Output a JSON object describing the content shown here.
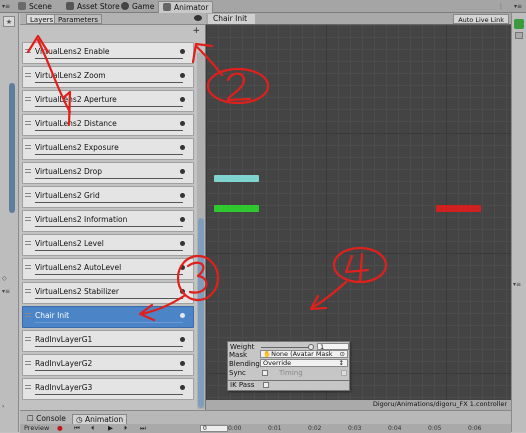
{
  "tabs": [
    {
      "label": "Scene",
      "icon": "scene-icon"
    },
    {
      "label": "Asset Store",
      "icon": "store-icon"
    },
    {
      "label": "Game",
      "icon": "game-icon"
    },
    {
      "label": "Animator",
      "icon": "animator-icon"
    }
  ],
  "layers_panel": {
    "tab_layers": "Layers",
    "tab_parameters": "Parameters",
    "add_label": "+",
    "items": [
      "VirtualLens2 Enable",
      "VirtualLens2 Zoom",
      "VirtualLens2 Aperture",
      "VirtualLens2 Distance",
      "VirtualLens2 Exposure",
      "VirtualLens2 Drop",
      "VirtualLens2 Grid",
      "VirtualLens2 Information",
      "VirtualLens2 Level",
      "VirtualLens2 AutoLevel",
      "VirtualLens2 Stabilizer",
      "Chair Init",
      "RadInvLayerG1",
      "RadInvLayerG2",
      "RadInvLayerG3"
    ],
    "selected": "Chair Init"
  },
  "graph": {
    "breadcrumb": "Chair Init",
    "auto_live_link": "Auto Live Link",
    "controller_path": "Digoru/Animations/digoru_FX 1.controller"
  },
  "layer_settings": {
    "weight_label": "Weight",
    "weight_value": "1",
    "mask_label": "Mask",
    "mask_value": "None (Avatar Mask",
    "blending_label": "Blending",
    "blending_value": "Override",
    "sync_label": "Sync",
    "timing_label": "Timing",
    "ik_pass_label": "IK Pass"
  },
  "bottom": {
    "console_label": "Console",
    "animation_label": "Animation",
    "preview_label": "Preview",
    "frame_value": "0",
    "timeline_marks": [
      "0:00",
      "0:01",
      "0:02",
      "0:03",
      "0:04",
      "0:05",
      "0:06"
    ]
  },
  "annotations": [
    "1",
    "2",
    "3",
    "4"
  ],
  "colors": {
    "selected": "#4c84c8",
    "annotation": "#e0201c",
    "node_entry": "#2fc82f",
    "node_exit": "#d02020",
    "node_state": "#7fd4d0"
  }
}
